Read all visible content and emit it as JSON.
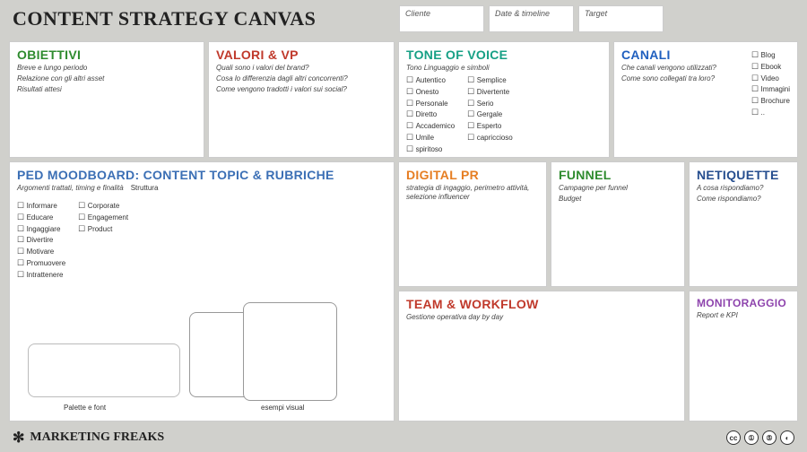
{
  "header": {
    "title": "CONTENT STRATEGY CANVAS",
    "cliente": "Cliente",
    "date": "Date & timeline",
    "target": "Target"
  },
  "obiettivi": {
    "title": "OBIETTIVI",
    "l1": "Breve e lungo periodo",
    "l2": "Relazione con gli altri asset",
    "l3": "Risultati attesi"
  },
  "valori": {
    "title": "VALORI & VP",
    "l1": "Quali sono i valori del brand?",
    "l2": "Cosa lo differenzia dagli altri concorrenti?",
    "l3": "Come vengono tradotti i valori sui social?"
  },
  "tone": {
    "title": "TONE OF VOICE",
    "sub": "Tono Linguaggio e simboli",
    "colA": [
      "Autentico",
      "Onesto",
      "Personale",
      "Diretto",
      "Accademico",
      "Umile",
      "spiritoso"
    ],
    "colB": [
      "Semplice",
      "Divertente",
      "Serio",
      "Gergale",
      "Esperto",
      "capriccioso"
    ]
  },
  "canali": {
    "title": "CANALI",
    "l1": "Che canali vengono utilizzati?",
    "l2": "Come sono collegati tra loro?",
    "items": [
      "Blog",
      "Ebook",
      "Video",
      "Immagini",
      "Brochure",
      ".."
    ]
  },
  "ped": {
    "title": "PED MOODBOARD: CONTENT TOPIC & RUBRICHE",
    "sub1": "Argomenti trattati, timing e finalità",
    "sub2": "Struttura",
    "colA": [
      "Informare",
      "Educare",
      "Ingaggiare",
      "Divertire",
      "Motivare",
      "Promuovere",
      "Intrattenere"
    ],
    "colB": [
      "Corporate",
      "Engagement",
      "Product"
    ],
    "palette": "Palette e font",
    "esempi": "esempi visual"
  },
  "pr": {
    "title": "DIGITAL PR",
    "sub": "strategia di ingaggio, perimetro attività, selezione influencer"
  },
  "funnel": {
    "title": "FUNNEL",
    "l1": "Campagne per funnel",
    "l2": "Budget"
  },
  "netiquette": {
    "title": "NETIQUETTE",
    "l1": "A cosa rispondiamo?",
    "l2": "Come rispondiamo?"
  },
  "team": {
    "title": "TEAM & WORKFLOW",
    "sub": "Gestione operativa day by day"
  },
  "monitor": {
    "title": "MONITORAGGIO",
    "sub": "Report e KPI"
  },
  "footer": {
    "brand": "MARKETING FREAKS",
    "cc": [
      "cc",
      "①",
      "⑤",
      "◐"
    ]
  },
  "colors": {
    "green": "#2e8b2e",
    "red": "#c0392b",
    "teal": "#16a085",
    "blue": "#1f5fbf",
    "orange": "#e67e22",
    "purple": "#8e44ad",
    "darkblue": "#264e8f",
    "pedblue": "#3b6fb5"
  }
}
